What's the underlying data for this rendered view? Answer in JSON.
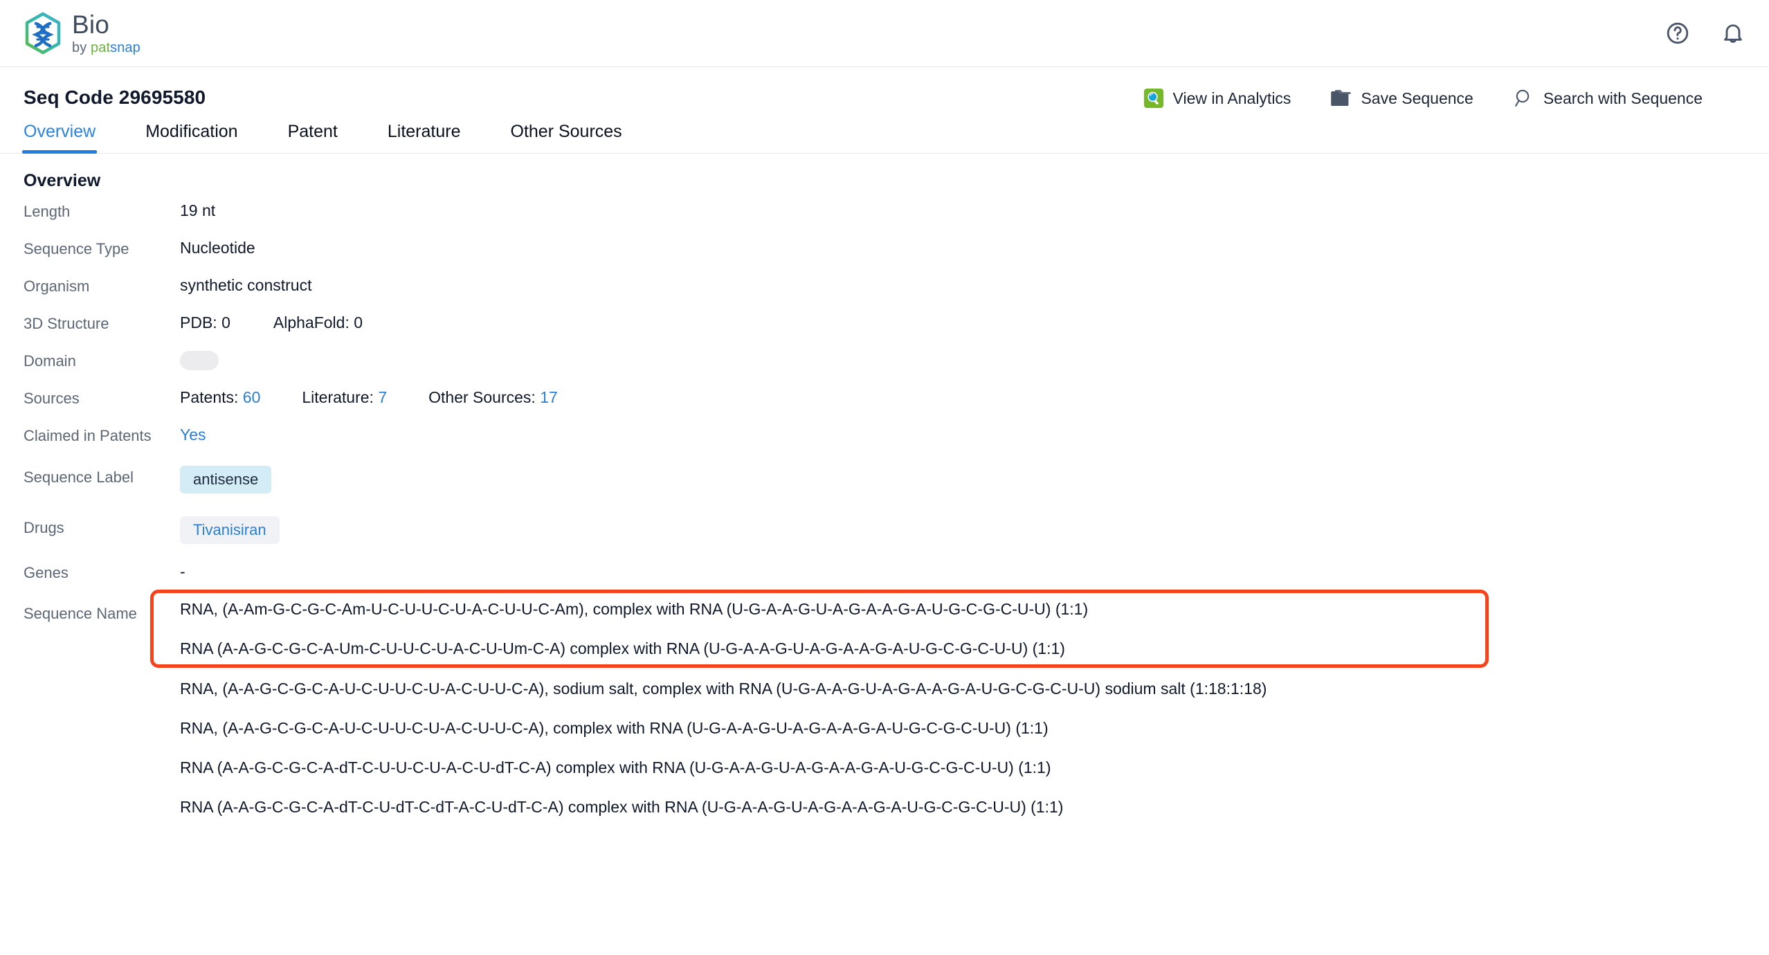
{
  "app": {
    "brand_title": "Bio",
    "brand_by": "by",
    "brand_pat": "pat",
    "brand_snap": "snap",
    "help_icon": "help-circle-icon",
    "bell_icon": "bell-icon"
  },
  "header": {
    "title": "Seq Code 29695580",
    "actions": [
      {
        "label": "View in Analytics",
        "icon": "analytics-search-icon"
      },
      {
        "label": "Save Sequence",
        "icon": "folder-save-icon"
      },
      {
        "label": "Search with Sequence",
        "icon": "magnifier-icon"
      }
    ]
  },
  "tabs": [
    {
      "label": "Overview",
      "active": true
    },
    {
      "label": "Modification",
      "active": false
    },
    {
      "label": "Patent",
      "active": false
    },
    {
      "label": "Literature",
      "active": false
    },
    {
      "label": "Other Sources",
      "active": false
    }
  ],
  "overview": {
    "section_title": "Overview",
    "length_label": "Length",
    "length_value": "19 nt",
    "sequence_type_label": "Sequence Type",
    "sequence_type_value": "Nucleotide",
    "organism_label": "Organism",
    "organism_value": "synthetic construct",
    "structure_label": "3D Structure",
    "structure_pdb": "PDB: 0",
    "structure_alphafold": "AlphaFold: 0",
    "domain_label": "Domain",
    "sources_label": "Sources",
    "sources_patents_text": "Patents:",
    "sources_patents_count": "60",
    "sources_literature_text": "Literature:",
    "sources_literature_count": "7",
    "sources_other_text": "Other Sources:",
    "sources_other_count": "17",
    "claimed_label": "Claimed in Patents",
    "claimed_value": "Yes",
    "sequence_label_label": "Sequence Label",
    "sequence_label_value": "antisense",
    "drugs_label": "Drugs",
    "drugs_value": "Tivanisiran",
    "genes_label": "Genes",
    "genes_value": "-",
    "sequence_name_label": "Sequence Name",
    "sequence_names": [
      "RNA, (A-Am-G-C-G-C-Am-U-C-U-U-C-U-A-C-U-U-C-Am), complex with RNA (U-G-A-A-G-U-A-G-A-A-G-A-U-G-C-G-C-U-U) (1:1)",
      "RNA (A-A-G-C-G-C-A-Um-C-U-U-C-U-A-C-U-Um-C-A) complex with RNA (U-G-A-A-G-U-A-G-A-A-G-A-U-G-C-G-C-U-U) (1:1)",
      "RNA, (A-A-G-C-G-C-A-U-C-U-U-C-U-A-C-U-U-C-A), sodium salt, complex with RNA (U-G-A-A-G-U-A-G-A-A-G-A-U-G-C-G-C-U-U) sodium salt (1:18:1:18)",
      "RNA, (A-A-G-C-G-C-A-U-C-U-U-C-U-A-C-U-U-C-A), complex with RNA (U-G-A-A-G-U-A-G-A-A-G-A-U-G-C-G-C-U-U) (1:1)",
      "RNA (A-A-G-C-G-C-A-dT-C-U-U-C-U-A-C-U-dT-C-A) complex with RNA (U-G-A-A-G-U-A-G-A-A-G-A-U-G-C-G-C-U-U) (1:1)",
      "RNA (A-A-G-C-G-C-A-dT-C-U-dT-C-dT-A-C-U-dT-C-A) complex with RNA (U-G-A-A-G-U-A-G-A-A-G-A-U-G-C-G-C-U-U) (1:1)"
    ],
    "highlighted_indices": [
      0,
      1
    ]
  },
  "colors": {
    "accent_blue": "#2b7fd4",
    "tab_active": "#2b83e0",
    "highlight_red": "#f5441c",
    "chip_label_bg": "#d3ecf6",
    "chip_drug_bg": "#f0f2f5"
  }
}
